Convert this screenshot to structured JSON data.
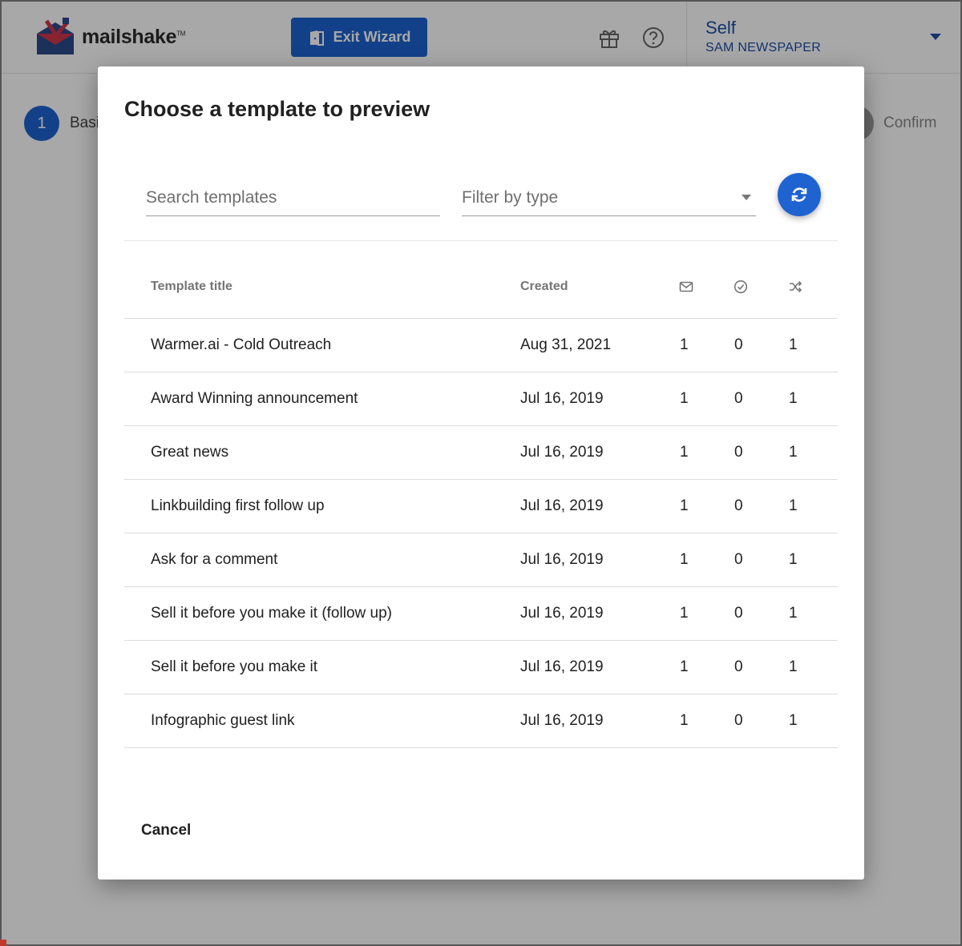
{
  "app": {
    "logo_text": "mailshake",
    "logo_mark": "TM",
    "exit_wizard_label": "Exit Wizard",
    "icons": [
      "door-icon",
      "gift-icon",
      "help-icon",
      "chevron-down-icon"
    ],
    "account": {
      "name": "Self",
      "team": "SAM NEWSPAPER"
    },
    "steps": [
      {
        "number": "1",
        "label": "Basi"
      },
      {
        "label": "Confirm"
      }
    ]
  },
  "modal": {
    "title": "Choose a template to preview",
    "search_placeholder": "Search templates",
    "filter_placeholder": "Filter by type",
    "refresh_icon": "refresh-icon",
    "columns": {
      "title": "Template title",
      "created": "Created",
      "icon1": "envelope-icon",
      "icon2": "check-circle-icon",
      "icon3": "shuffle-icon"
    },
    "rows": [
      {
        "title": "Warmer.ai - Cold Outreach",
        "created": "Aug 31, 2021",
        "n1": "1",
        "n2": "0",
        "n3": "1"
      },
      {
        "title": "Award Winning announcement",
        "created": "Jul 16, 2019",
        "n1": "1",
        "n2": "0",
        "n3": "1"
      },
      {
        "title": "Great news",
        "created": "Jul 16, 2019",
        "n1": "1",
        "n2": "0",
        "n3": "1"
      },
      {
        "title": "Linkbuilding first follow up",
        "created": "Jul 16, 2019",
        "n1": "1",
        "n2": "0",
        "n3": "1"
      },
      {
        "title": "Ask for a comment",
        "created": "Jul 16, 2019",
        "n1": "1",
        "n2": "0",
        "n3": "1"
      },
      {
        "title": "Sell it before you make it (follow up)",
        "created": "Jul 16, 2019",
        "n1": "1",
        "n2": "0",
        "n3": "1"
      },
      {
        "title": "Sell it before you make it",
        "created": "Jul 16, 2019",
        "n1": "1",
        "n2": "0",
        "n3": "1"
      },
      {
        "title": "Infographic guest link",
        "created": "Jul 16, 2019",
        "n1": "1",
        "n2": "0",
        "n3": "1"
      }
    ],
    "cancel_label": "Cancel"
  },
  "colors": {
    "primary": "#1e63d0",
    "account": "#1e4fa8",
    "logo_red": "#d1344b",
    "logo_navy": "#2a4a8a"
  }
}
